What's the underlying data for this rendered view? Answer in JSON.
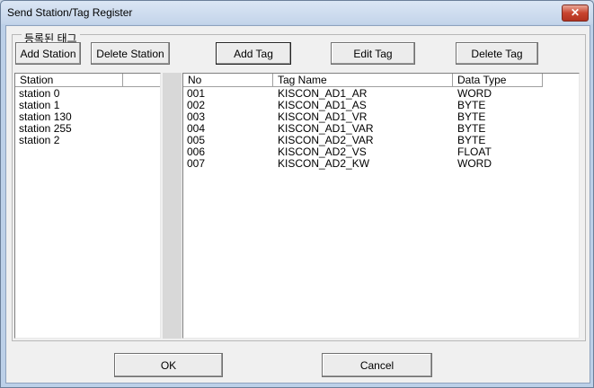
{
  "window": {
    "title": "Send Station/Tag Register",
    "close_label": "✕"
  },
  "group": {
    "label": "등록된 태그"
  },
  "toolbar": {
    "add_station": "Add Station",
    "delete_station": "Delete Station",
    "add_tag": "Add Tag",
    "edit_tag": "Edit Tag",
    "delete_tag": "Delete Tag"
  },
  "stations": {
    "header": "Station",
    "items": [
      "station 0",
      "station 1",
      "station 130",
      "station 255",
      "station 2"
    ]
  },
  "tags": {
    "columns": [
      "No",
      "Tag Name",
      "Data Type"
    ],
    "rows": [
      [
        "001",
        "KISCON_AD1_AR",
        "WORD"
      ],
      [
        "002",
        "KISCON_AD1_AS",
        "BYTE"
      ],
      [
        "003",
        "KISCON_AD1_VR",
        "BYTE"
      ],
      [
        "004",
        "KISCON_AD1_VAR",
        "BYTE"
      ],
      [
        "005",
        "KISCON_AD2_VAR",
        "BYTE"
      ],
      [
        "006",
        "KISCON_AD2_VS",
        "FLOAT"
      ],
      [
        "007",
        "KISCON_AD2_KW",
        "WORD"
      ]
    ]
  },
  "footer": {
    "ok": "OK",
    "cancel": "Cancel"
  }
}
